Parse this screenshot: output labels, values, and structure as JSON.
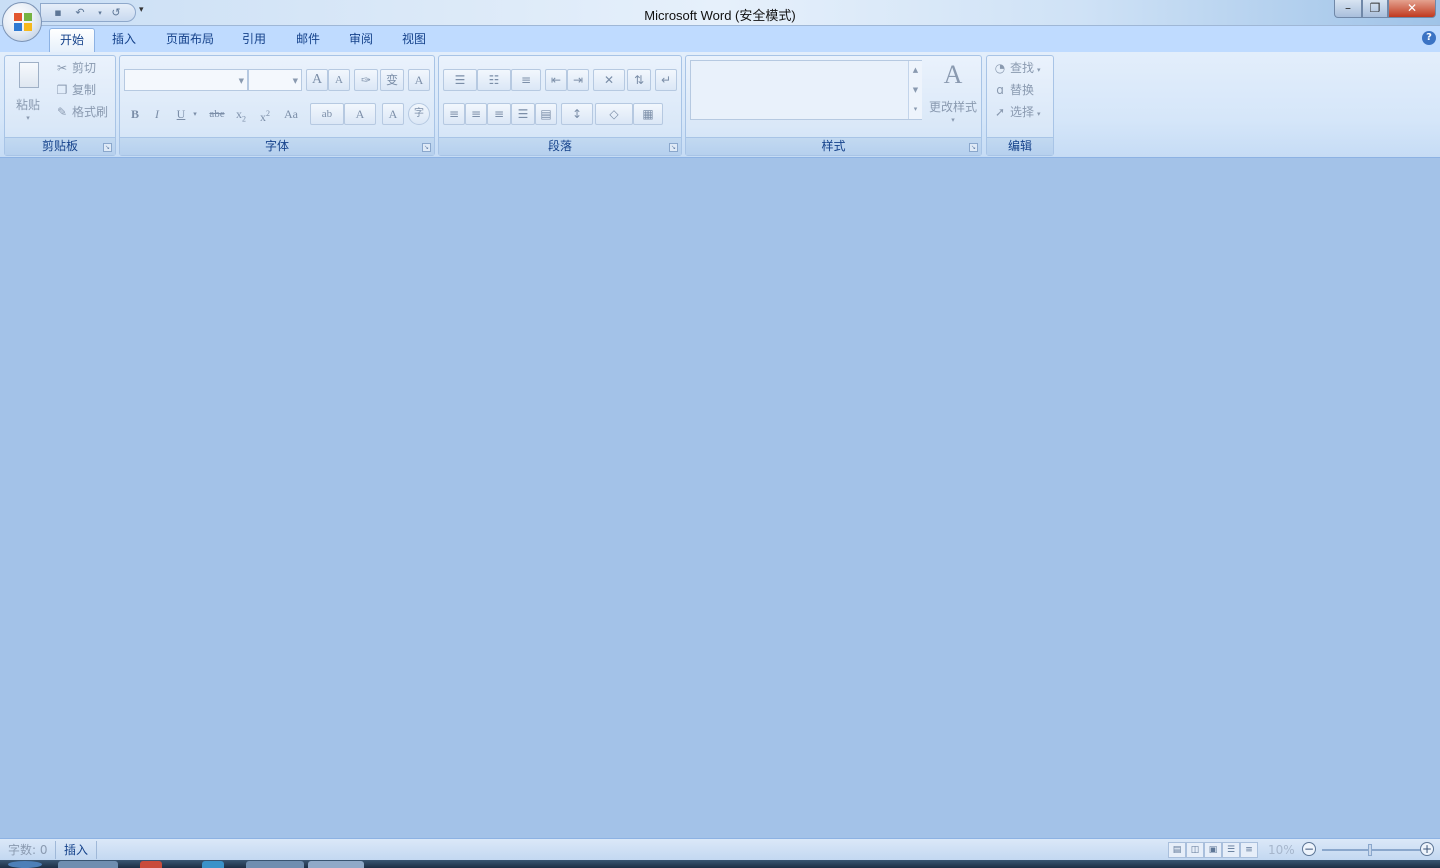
{
  "window": {
    "title": "Microsoft Word (安全模式)",
    "controls": {
      "minimize": "–",
      "maximize": "❐",
      "close": "✕"
    }
  },
  "qat": {
    "save_icon": "save-icon",
    "undo_icon": "undo-icon",
    "redo_icon": "redo-icon",
    "more": "▾"
  },
  "tabs": [
    {
      "label": "开始",
      "active": true
    },
    {
      "label": "插入"
    },
    {
      "label": "页面布局"
    },
    {
      "label": "引用"
    },
    {
      "label": "邮件"
    },
    {
      "label": "审阅"
    },
    {
      "label": "视图"
    }
  ],
  "help": "?",
  "clipboard": {
    "label": "剪贴板",
    "paste": "粘贴",
    "cut": "剪切",
    "copy": "复制",
    "format_painter": "格式刷"
  },
  "font": {
    "label": "字体",
    "font_name": "",
    "font_size": "",
    "grow": "A",
    "shrink": "A",
    "bold": "B",
    "italic": "I",
    "underline": "U",
    "strikethrough": "abe",
    "subscript": "x",
    "superscript": "x",
    "change_case": "Aa",
    "highlight": "ab",
    "font_color": "A",
    "char_shading": "A",
    "enclose": "字",
    "phonetic": "变"
  },
  "paragraph": {
    "label": "段落"
  },
  "styles": {
    "label": "样式",
    "change_styles": "更改样式"
  },
  "editing": {
    "label": "编辑",
    "find": "查找",
    "replace": "替换",
    "select": "选择"
  },
  "status": {
    "word_count": "字数: 0",
    "insert_mode": "插入",
    "zoom": "10%"
  },
  "colors": {
    "ribbon_bg": "#dae8f8",
    "doc_bg": "#a3c2e8",
    "tab_text": "#15428b",
    "close_red": "#c0391f"
  }
}
